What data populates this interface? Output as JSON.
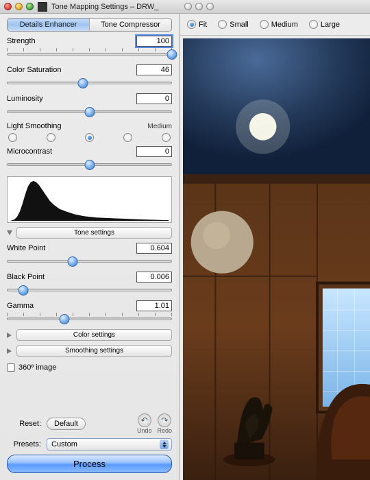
{
  "window": {
    "title": "Tone Mapping Settings – DRW_"
  },
  "tabs": {
    "details": "Details Enhancer",
    "compressor": "Tone Compressor",
    "active": "details"
  },
  "params": {
    "strength": {
      "label": "Strength",
      "value": "100",
      "pos": 100
    },
    "color_saturation": {
      "label": "Color Saturation",
      "value": "46",
      "pos": 46
    },
    "luminosity": {
      "label": "Luminosity",
      "value": "0",
      "pos": 50
    },
    "light_smoothing": {
      "label": "Light Smoothing",
      "level_label": "Medium",
      "selected_index": 2,
      "options": 5
    },
    "microcontrast": {
      "label": "Microcontrast",
      "value": "0",
      "pos": 50
    },
    "white_point": {
      "label": "White Point",
      "value": "0.604",
      "pos": 40
    },
    "black_point": {
      "label": "Black Point",
      "value": "0.006",
      "pos": 10
    },
    "gamma": {
      "label": "Gamma",
      "value": "1.01",
      "pos": 35
    }
  },
  "sections": {
    "tone": "Tone settings",
    "color": "Color settings",
    "smoothing": "Smoothing settings"
  },
  "checkbox360": "360º image",
  "reset": {
    "label": "Reset:",
    "button": "Default",
    "undo": "Undo",
    "redo": "Redo"
  },
  "presets": {
    "label": "Presets:",
    "value": "Custom"
  },
  "process": "Process",
  "zoom": {
    "fit": "Fit",
    "small": "Small",
    "medium": "Medium",
    "large": "Large",
    "selected": "fit"
  }
}
